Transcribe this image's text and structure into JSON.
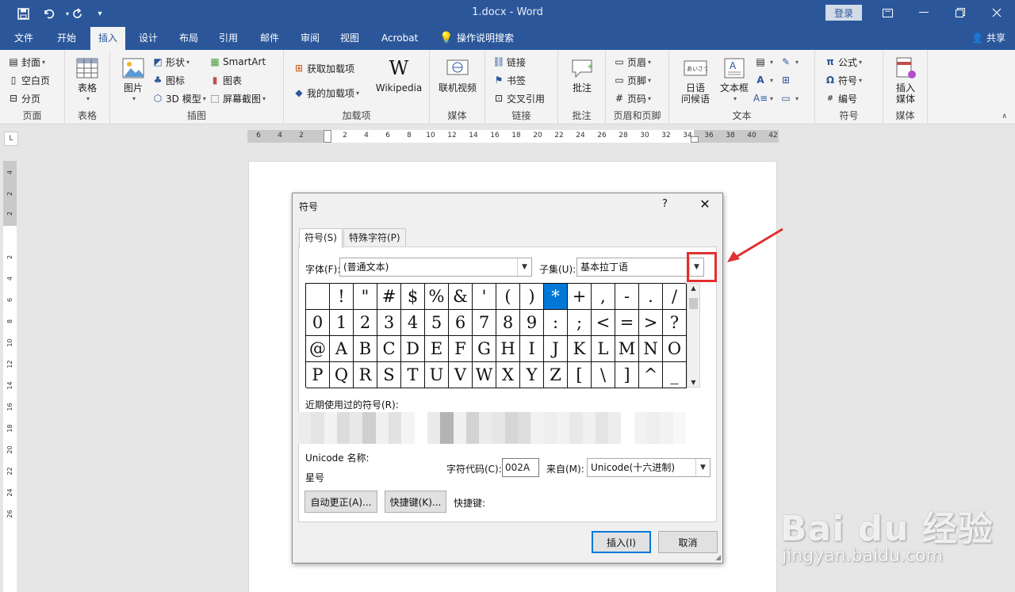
{
  "titlebar": {
    "doc_title": "1.docx  -  Word",
    "login": "登录",
    "icons": [
      "save-icon",
      "undo-icon",
      "redo-icon",
      "customize-icon",
      "ribbon-options-icon",
      "minimize-icon",
      "restore-icon",
      "close-icon"
    ]
  },
  "tabs": [
    "文件",
    "开始",
    "插入",
    "设计",
    "布局",
    "引用",
    "邮件",
    "审阅",
    "视图",
    "Acrobat",
    "操作说明搜索"
  ],
  "active_tab": "插入",
  "share": "共享",
  "ribbon": {
    "pages": {
      "label": "页面",
      "cover": "封面",
      "blank": "空白页",
      "break": "分页"
    },
    "tables": {
      "label": "表格",
      "table": "表格"
    },
    "illustrations": {
      "label": "插图",
      "picture": "图片",
      "shapes": "形状",
      "icons": "图标",
      "model3d": "3D 模型",
      "smartart": "SmartArt",
      "chart": "图表",
      "screenshot": "屏幕截图"
    },
    "addins": {
      "label": "加载项",
      "get": "获取加载项",
      "my": "我的加载项",
      "wikipedia": "Wikipedia"
    },
    "media": {
      "label": "媒体",
      "online_video": "联机视频"
    },
    "links": {
      "label": "链接",
      "link": "链接",
      "bookmark": "书签",
      "crossref": "交叉引用"
    },
    "comments": {
      "label": "批注",
      "comment": "批注"
    },
    "header_footer": {
      "label": "页眉和页脚",
      "header": "页眉",
      "footer": "页脚",
      "page_number": "页码"
    },
    "text": {
      "label": "文本",
      "greeting_line1": "日语",
      "greeting_line2": "问候语",
      "textbox": "文本框"
    },
    "symbols": {
      "label": "符号",
      "equation": "公式",
      "symbol": "符号",
      "number": "编号"
    },
    "media2": {
      "label": "媒体",
      "insert_line1": "插入",
      "insert_line2": "媒体"
    }
  },
  "ruler": {
    "h_numbers": [
      "6",
      "4",
      "2",
      "2",
      "4",
      "6",
      "8",
      "10",
      "12",
      "14",
      "16",
      "18",
      "20",
      "22",
      "24",
      "26",
      "28",
      "30",
      "32",
      "34",
      "36",
      "38",
      "40",
      "42"
    ],
    "v_numbers": [
      "4",
      "2",
      "2",
      "2",
      "4",
      "6",
      "8",
      "10",
      "12",
      "14",
      "16",
      "18",
      "20",
      "22",
      "24",
      "26"
    ]
  },
  "dialog": {
    "title": "符号",
    "help": "?",
    "tabs": [
      "符号(S)",
      "特殊字符(P)"
    ],
    "font_label": "字体(F):",
    "font_value": "(普通文本)",
    "subset_label": "子集(U):",
    "subset_value": "基本拉丁语",
    "symbols": [
      " ",
      "!",
      "\"",
      "#",
      "$",
      "%",
      "&",
      "'",
      "(",
      ")",
      "*",
      "+",
      ",",
      "-",
      ".",
      "/",
      "0",
      "1",
      "2",
      "3",
      "4",
      "5",
      "6",
      "7",
      "8",
      "9",
      ":",
      ";",
      "<",
      "=",
      ">",
      "?",
      "@",
      "A",
      "B",
      "C",
      "D",
      "E",
      "F",
      "G",
      "H",
      "I",
      "J",
      "K",
      "L",
      "M",
      "N",
      "O",
      "P",
      "Q",
      "R",
      "S",
      "T",
      "U",
      "V",
      "W",
      "X",
      "Y",
      "Z",
      "[",
      "\\",
      "]",
      "^",
      "_"
    ],
    "selected_index": 10,
    "recent_label": "近期使用过的符号(R):",
    "recent_shades": [
      "#ececec",
      "#e4e4e4",
      "#f2f2f2",
      "#dcdcdc",
      "#e8e8e8",
      "#cfcfcf",
      "#f0f0f0",
      "#e2e2e2",
      "#f4f4f4",
      "#ffffff",
      "#eaeaea",
      "#b4b4b4",
      "#f0f0f0",
      "#d2d2d2",
      "#ececec",
      "#e6e6e6",
      "#d6d6d6",
      "#dedede",
      "#f2f2f2",
      "#eeeeee",
      "#f2f2f2",
      "#e8e8e8",
      "#f0f0f0",
      "#e4e4e4",
      "#ededed",
      "#ffffff",
      "#f3f3f3",
      "#eeeeee",
      "#f2f2f2",
      "#f8f8f8"
    ],
    "unicode_name_label": "Unicode 名称:",
    "unicode_name": "星号",
    "charcode_label": "字符代码(C):",
    "charcode_value": "002A",
    "from_label": "来自(M):",
    "from_value": "Unicode(十六进制)",
    "autocorrect": "自动更正(A)...",
    "shortcut_key_btn": "快捷键(K)...",
    "shortcut_label": "快捷键:",
    "insert": "插入(I)",
    "cancel": "取消"
  },
  "annotation_color": "#e03030",
  "watermark": {
    "logo": "Bai du 经验",
    "url": "jingyan.baidu.com"
  }
}
